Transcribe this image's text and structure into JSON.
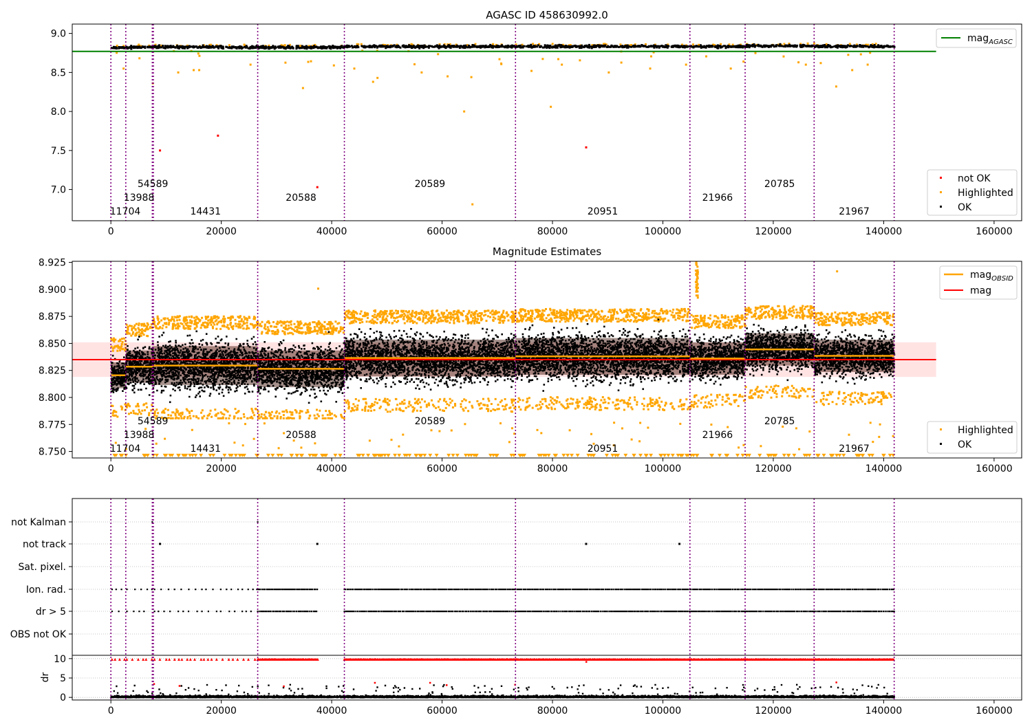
{
  "figure": {
    "background": "#ffffff"
  },
  "colors": {
    "ok": "#000000",
    "highlighted": "#ffa500",
    "not_ok": "#ff0000",
    "agasc_line": "#008000",
    "obsid_line": "#ffa500",
    "mag_line": "#ff0000",
    "mag_band": "#ffcccc",
    "obs_band": "#3a0a00",
    "obs_sep": "#800080",
    "grid": "#b0b0b0"
  },
  "obsids": [
    {
      "id": "11704",
      "start": 0,
      "end": 2700,
      "level": 0,
      "mag": 8.8205,
      "std": 0.012
    },
    {
      "id": "13988",
      "start": 2700,
      "end": 7500,
      "level": 1,
      "mag": 8.8285,
      "std": 0.015
    },
    {
      "id": "54589",
      "start": 7500,
      "end": 7700,
      "level": 2,
      "mag": 8.829,
      "std": 0.018
    },
    {
      "id": "14431",
      "start": 7700,
      "end": 26600,
      "level": 0,
      "mag": 8.8295,
      "std": 0.018
    },
    {
      "id": "20588",
      "start": 26600,
      "end": 42300,
      "level": 1,
      "mag": 8.8265,
      "std": 0.017
    },
    {
      "id": "20589",
      "start": 42300,
      "end": 73300,
      "level": 2,
      "mag": 8.8365,
      "std": 0.017
    },
    {
      "id": "20951",
      "start": 73300,
      "end": 104900,
      "level": 0,
      "mag": 8.838,
      "std": 0.017
    },
    {
      "id": "21966",
      "start": 104900,
      "end": 114900,
      "level": 1,
      "mag": 8.836,
      "std": 0.015
    },
    {
      "id": "20785",
      "start": 114900,
      "end": 127400,
      "level": 2,
      "mag": 8.8445,
      "std": 0.015
    },
    {
      "id": "21967",
      "start": 127400,
      "end": 141900,
      "level": 0,
      "mag": 8.8385,
      "std": 0.015
    }
  ],
  "chart_data": [
    {
      "type": "scatter",
      "title": "AGASC ID 458630992.0",
      "xlim": [
        -7000,
        165000
      ],
      "ylim": [
        6.6,
        9.12
      ],
      "xticks": [
        0,
        20000,
        40000,
        60000,
        80000,
        100000,
        120000,
        140000,
        160000
      ],
      "xtick_labels": [
        "0",
        "20000",
        "40000",
        "60000",
        "80000",
        "100000",
        "120000",
        "140000",
        "160000"
      ],
      "yticks": [
        7.0,
        7.5,
        8.0,
        8.5,
        9.0
      ],
      "ytick_labels": [
        "7.0",
        "7.5",
        "8.0",
        "8.5",
        "9.0"
      ],
      "mag_agasc": 8.77,
      "mag_agasc_xrange": [
        -7000,
        149500
      ],
      "legend_top": {
        "position": "top-right",
        "items": [
          {
            "label": "mag",
            "subscript": "AGASC"
          }
        ]
      },
      "legend_bottom": {
        "position": "bottom-right",
        "items": [
          "not OK",
          "Highlighted",
          "OK"
        ]
      },
      "not_ok_points": [
        {
          "x": 8900,
          "y": 7.5
        },
        {
          "x": 19400,
          "y": 7.69
        },
        {
          "x": 37400,
          "y": 7.03
        },
        {
          "x": 86100,
          "y": 7.54
        }
      ],
      "highlighted_outliers": [
        {
          "x": 7600,
          "y": 8.36
        },
        {
          "x": 2300,
          "y": 8.55
        },
        {
          "x": 34800,
          "y": 8.3
        },
        {
          "x": 47500,
          "y": 8.38
        },
        {
          "x": 48300,
          "y": 8.43
        },
        {
          "x": 64000,
          "y": 8.0
        },
        {
          "x": 65500,
          "y": 6.81
        },
        {
          "x": 79700,
          "y": 8.06
        },
        {
          "x": 131400,
          "y": 8.32
        },
        {
          "x": 12200,
          "y": 8.5
        },
        {
          "x": 15000,
          "y": 8.53
        },
        {
          "x": 16000,
          "y": 8.53
        },
        {
          "x": 25300,
          "y": 8.6
        },
        {
          "x": 40400,
          "y": 8.59
        },
        {
          "x": 44100,
          "y": 8.55
        },
        {
          "x": 56300,
          "y": 8.5
        },
        {
          "x": 61000,
          "y": 8.45
        },
        {
          "x": 65300,
          "y": 8.44
        },
        {
          "x": 70400,
          "y": 8.67
        },
        {
          "x": 76200,
          "y": 8.52
        },
        {
          "x": 81700,
          "y": 8.6
        },
        {
          "x": 90200,
          "y": 8.5
        },
        {
          "x": 97700,
          "y": 8.55
        },
        {
          "x": 104200,
          "y": 8.6
        },
        {
          "x": 112300,
          "y": 8.55
        },
        {
          "x": 125900,
          "y": 8.6
        },
        {
          "x": 128600,
          "y": 8.62
        },
        {
          "x": 134300,
          "y": 8.53
        },
        {
          "x": 137100,
          "y": 8.6
        }
      ]
    },
    {
      "type": "scatter",
      "title": "Magnitude Estimates",
      "xlim": [
        -7000,
        165000
      ],
      "ylim": [
        8.744,
        8.926
      ],
      "xticks": [
        0,
        20000,
        40000,
        60000,
        80000,
        100000,
        120000,
        140000,
        160000
      ],
      "xtick_labels": [
        "0",
        "20000",
        "40000",
        "60000",
        "80000",
        "100000",
        "120000",
        "140000",
        "160000"
      ],
      "yticks": [
        8.75,
        8.775,
        8.8,
        8.825,
        8.85,
        8.875,
        8.9,
        8.925
      ],
      "ytick_labels": [
        "8.750",
        "8.775",
        "8.800",
        "8.825",
        "8.850",
        "8.875",
        "8.900",
        "8.925"
      ],
      "mag": 8.835,
      "mag_band": [
        8.819,
        8.851
      ],
      "mag_xrange": [
        -7000,
        149500
      ],
      "legend_top": {
        "position": "top-right",
        "items": [
          {
            "label": "mag",
            "subscript": "OBSID"
          },
          {
            "label": "mag"
          }
        ]
      },
      "legend_bottom": {
        "position": "bottom-right",
        "items": [
          "Highlighted",
          "OK"
        ]
      }
    },
    {
      "type": "scatter",
      "xlim": [
        -7000,
        165000
      ],
      "xticks": [
        0,
        20000,
        40000,
        60000,
        80000,
        100000,
        120000,
        140000,
        160000
      ],
      "xtick_labels": [
        "0",
        "20000",
        "40000",
        "60000",
        "80000",
        "100000",
        "120000",
        "140000",
        "160000"
      ],
      "flag_labels": [
        "not Kalman",
        "not track",
        "Sat. pixel.",
        "Ion. rad.",
        "dr > 5",
        "OBS not OK"
      ],
      "ylabel": "dr",
      "dr_ylim": [
        -0.5,
        10.5
      ],
      "dr_yticks": [
        0,
        5,
        10
      ],
      "dr_ytick_labels": [
        "0",
        "5",
        "10"
      ],
      "not_track_points": [
        8900,
        37400,
        86100,
        103000
      ],
      "not_kalman_points": [
        7500,
        26600
      ]
    }
  ]
}
